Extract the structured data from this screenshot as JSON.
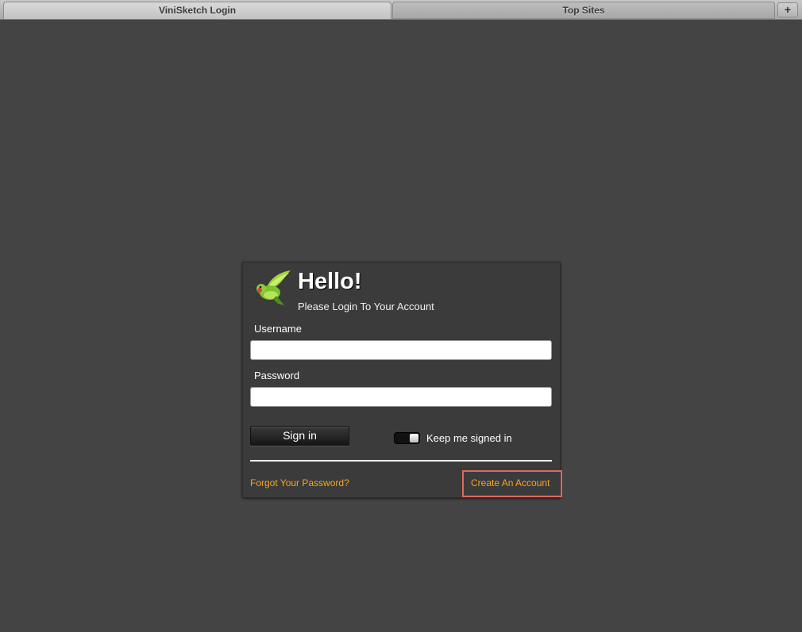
{
  "tabs": [
    {
      "label": "ViniSketch Login",
      "active": true
    },
    {
      "label": "Top Sites",
      "active": false
    }
  ],
  "new_tab_glyph": "+",
  "login": {
    "icon": "hummingbird-logo",
    "title": "Hello!",
    "subtitle": "Please Login To Your Account",
    "username_label": "Username",
    "username_value": "",
    "password_label": "Password",
    "password_value": "",
    "signin_label": "Sign in",
    "keep_signed_in_label": "Keep me signed in",
    "keep_signed_in": true,
    "forgot_label": "Forgot Your Password?",
    "create_label": "Create An Account"
  },
  "colors": {
    "background": "#444444",
    "card": "#3b3b3b",
    "link": "#f5a623",
    "highlight": "#e2675a"
  }
}
